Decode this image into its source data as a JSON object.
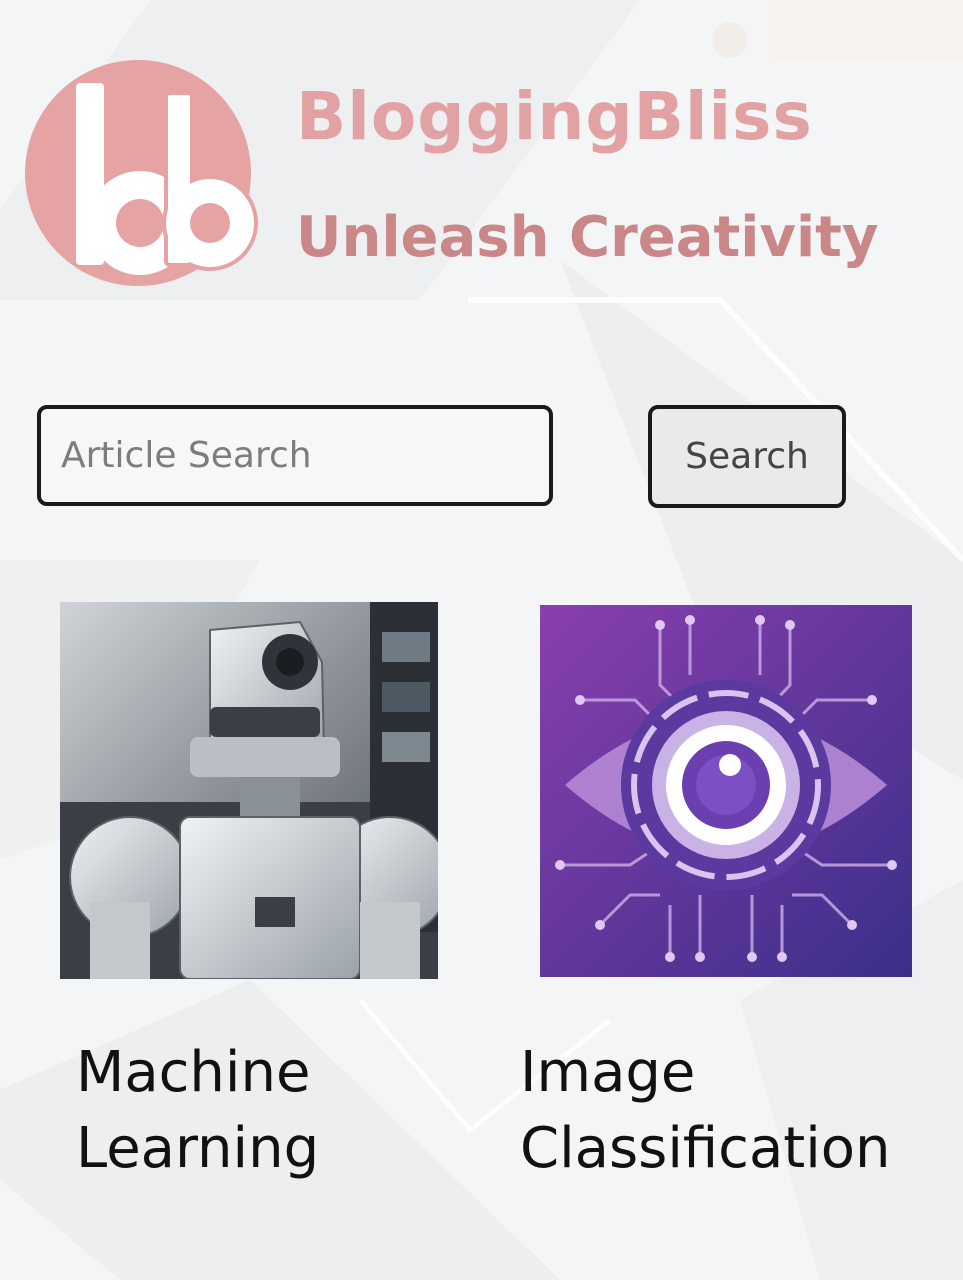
{
  "brand": {
    "logo_letters": "bb",
    "title": "BloggingBliss",
    "tagline": "Unleash Creativity",
    "colors": {
      "logo_circle": "#e6a3a4",
      "title": "#e2a1a3",
      "tagline": "#c98787"
    }
  },
  "search": {
    "placeholder": "Article Search",
    "value": "",
    "button_label": "Search"
  },
  "articles": [
    {
      "title_line1": "Machine",
      "title_line2": "Learning",
      "image_icon": "robot-image"
    },
    {
      "title_line1": "Image",
      "title_line2": "Classification",
      "image_icon": "ai-eye-circuit-image"
    }
  ]
}
